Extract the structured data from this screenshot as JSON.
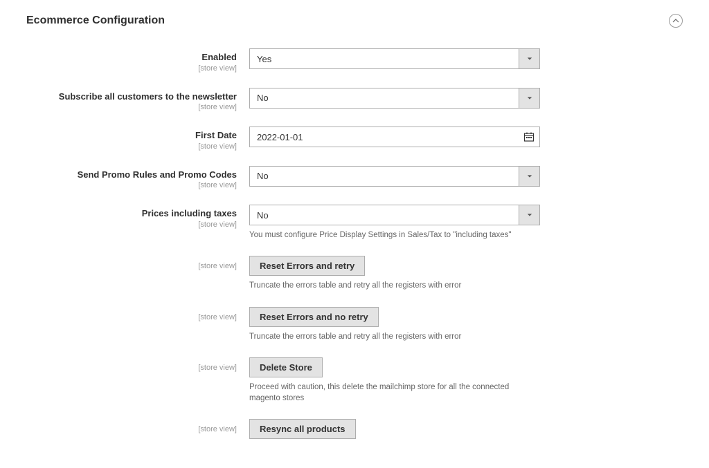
{
  "section": {
    "title": "Ecommerce Configuration",
    "scope_text": "[store view]"
  },
  "fields": {
    "enabled": {
      "label": "Enabled",
      "value": "Yes"
    },
    "subscribe": {
      "label": "Subscribe all customers to the newsletter",
      "value": "No"
    },
    "first_date": {
      "label": "First Date",
      "value": "2022-01-01"
    },
    "promo": {
      "label": "Send Promo Rules and Promo Codes",
      "value": "No"
    },
    "prices_tax": {
      "label": "Prices including taxes",
      "value": "No",
      "hint": "You must configure Price Display Settings in Sales/Tax to \"including taxes\""
    }
  },
  "buttons": {
    "reset_retry": {
      "label": "Reset Errors and retry",
      "hint": "Truncate the errors table and retry all the registers with error"
    },
    "reset_no_retry": {
      "label": "Reset Errors and no retry",
      "hint": "Truncate the errors table and retry all the registers with error"
    },
    "delete_store": {
      "label": "Delete Store",
      "hint": "Proceed with caution, this delete the mailchimp store for all the connected magento stores"
    },
    "resync": {
      "label": "Resync all products"
    }
  }
}
